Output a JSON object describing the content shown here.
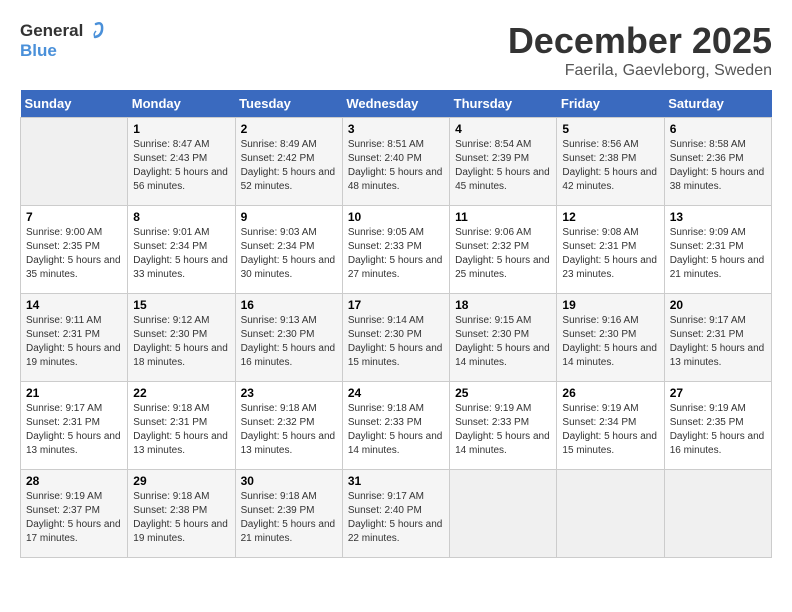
{
  "header": {
    "logo_general": "General",
    "logo_blue": "Blue",
    "month": "December 2025",
    "location": "Faerila, Gaevleborg, Sweden"
  },
  "weekdays": [
    "Sunday",
    "Monday",
    "Tuesday",
    "Wednesday",
    "Thursday",
    "Friday",
    "Saturday"
  ],
  "weeks": [
    [
      {
        "day": "",
        "sunrise": "",
        "sunset": "",
        "daylight": ""
      },
      {
        "day": "1",
        "sunrise": "Sunrise: 8:47 AM",
        "sunset": "Sunset: 2:43 PM",
        "daylight": "Daylight: 5 hours and 56 minutes."
      },
      {
        "day": "2",
        "sunrise": "Sunrise: 8:49 AM",
        "sunset": "Sunset: 2:42 PM",
        "daylight": "Daylight: 5 hours and 52 minutes."
      },
      {
        "day": "3",
        "sunrise": "Sunrise: 8:51 AM",
        "sunset": "Sunset: 2:40 PM",
        "daylight": "Daylight: 5 hours and 48 minutes."
      },
      {
        "day": "4",
        "sunrise": "Sunrise: 8:54 AM",
        "sunset": "Sunset: 2:39 PM",
        "daylight": "Daylight: 5 hours and 45 minutes."
      },
      {
        "day": "5",
        "sunrise": "Sunrise: 8:56 AM",
        "sunset": "Sunset: 2:38 PM",
        "daylight": "Daylight: 5 hours and 42 minutes."
      },
      {
        "day": "6",
        "sunrise": "Sunrise: 8:58 AM",
        "sunset": "Sunset: 2:36 PM",
        "daylight": "Daylight: 5 hours and 38 minutes."
      }
    ],
    [
      {
        "day": "7",
        "sunrise": "Sunrise: 9:00 AM",
        "sunset": "Sunset: 2:35 PM",
        "daylight": "Daylight: 5 hours and 35 minutes."
      },
      {
        "day": "8",
        "sunrise": "Sunrise: 9:01 AM",
        "sunset": "Sunset: 2:34 PM",
        "daylight": "Daylight: 5 hours and 33 minutes."
      },
      {
        "day": "9",
        "sunrise": "Sunrise: 9:03 AM",
        "sunset": "Sunset: 2:34 PM",
        "daylight": "Daylight: 5 hours and 30 minutes."
      },
      {
        "day": "10",
        "sunrise": "Sunrise: 9:05 AM",
        "sunset": "Sunset: 2:33 PM",
        "daylight": "Daylight: 5 hours and 27 minutes."
      },
      {
        "day": "11",
        "sunrise": "Sunrise: 9:06 AM",
        "sunset": "Sunset: 2:32 PM",
        "daylight": "Daylight: 5 hours and 25 minutes."
      },
      {
        "day": "12",
        "sunrise": "Sunrise: 9:08 AM",
        "sunset": "Sunset: 2:31 PM",
        "daylight": "Daylight: 5 hours and 23 minutes."
      },
      {
        "day": "13",
        "sunrise": "Sunrise: 9:09 AM",
        "sunset": "Sunset: 2:31 PM",
        "daylight": "Daylight: 5 hours and 21 minutes."
      }
    ],
    [
      {
        "day": "14",
        "sunrise": "Sunrise: 9:11 AM",
        "sunset": "Sunset: 2:31 PM",
        "daylight": "Daylight: 5 hours and 19 minutes."
      },
      {
        "day": "15",
        "sunrise": "Sunrise: 9:12 AM",
        "sunset": "Sunset: 2:30 PM",
        "daylight": "Daylight: 5 hours and 18 minutes."
      },
      {
        "day": "16",
        "sunrise": "Sunrise: 9:13 AM",
        "sunset": "Sunset: 2:30 PM",
        "daylight": "Daylight: 5 hours and 16 minutes."
      },
      {
        "day": "17",
        "sunrise": "Sunrise: 9:14 AM",
        "sunset": "Sunset: 2:30 PM",
        "daylight": "Daylight: 5 hours and 15 minutes."
      },
      {
        "day": "18",
        "sunrise": "Sunrise: 9:15 AM",
        "sunset": "Sunset: 2:30 PM",
        "daylight": "Daylight: 5 hours and 14 minutes."
      },
      {
        "day": "19",
        "sunrise": "Sunrise: 9:16 AM",
        "sunset": "Sunset: 2:30 PM",
        "daylight": "Daylight: 5 hours and 14 minutes."
      },
      {
        "day": "20",
        "sunrise": "Sunrise: 9:17 AM",
        "sunset": "Sunset: 2:31 PM",
        "daylight": "Daylight: 5 hours and 13 minutes."
      }
    ],
    [
      {
        "day": "21",
        "sunrise": "Sunrise: 9:17 AM",
        "sunset": "Sunset: 2:31 PM",
        "daylight": "Daylight: 5 hours and 13 minutes."
      },
      {
        "day": "22",
        "sunrise": "Sunrise: 9:18 AM",
        "sunset": "Sunset: 2:31 PM",
        "daylight": "Daylight: 5 hours and 13 minutes."
      },
      {
        "day": "23",
        "sunrise": "Sunrise: 9:18 AM",
        "sunset": "Sunset: 2:32 PM",
        "daylight": "Daylight: 5 hours and 13 minutes."
      },
      {
        "day": "24",
        "sunrise": "Sunrise: 9:18 AM",
        "sunset": "Sunset: 2:33 PM",
        "daylight": "Daylight: 5 hours and 14 minutes."
      },
      {
        "day": "25",
        "sunrise": "Sunrise: 9:19 AM",
        "sunset": "Sunset: 2:33 PM",
        "daylight": "Daylight: 5 hours and 14 minutes."
      },
      {
        "day": "26",
        "sunrise": "Sunrise: 9:19 AM",
        "sunset": "Sunset: 2:34 PM",
        "daylight": "Daylight: 5 hours and 15 minutes."
      },
      {
        "day": "27",
        "sunrise": "Sunrise: 9:19 AM",
        "sunset": "Sunset: 2:35 PM",
        "daylight": "Daylight: 5 hours and 16 minutes."
      }
    ],
    [
      {
        "day": "28",
        "sunrise": "Sunrise: 9:19 AM",
        "sunset": "Sunset: 2:37 PM",
        "daylight": "Daylight: 5 hours and 17 minutes."
      },
      {
        "day": "29",
        "sunrise": "Sunrise: 9:18 AM",
        "sunset": "Sunset: 2:38 PM",
        "daylight": "Daylight: 5 hours and 19 minutes."
      },
      {
        "day": "30",
        "sunrise": "Sunrise: 9:18 AM",
        "sunset": "Sunset: 2:39 PM",
        "daylight": "Daylight: 5 hours and 21 minutes."
      },
      {
        "day": "31",
        "sunrise": "Sunrise: 9:17 AM",
        "sunset": "Sunset: 2:40 PM",
        "daylight": "Daylight: 5 hours and 22 minutes."
      },
      {
        "day": "",
        "sunrise": "",
        "sunset": "",
        "daylight": ""
      },
      {
        "day": "",
        "sunrise": "",
        "sunset": "",
        "daylight": ""
      },
      {
        "day": "",
        "sunrise": "",
        "sunset": "",
        "daylight": ""
      }
    ]
  ]
}
